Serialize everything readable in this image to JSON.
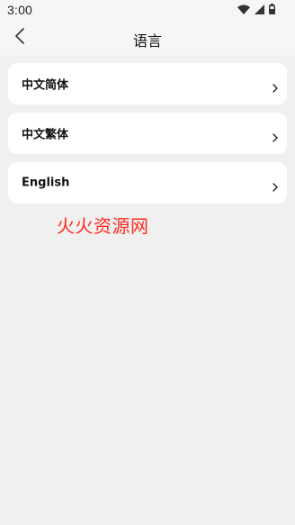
{
  "status_bar": {
    "time": "3:00",
    "icons": [
      "wifi-icon",
      "cellular-signal-icon",
      "battery-icon"
    ]
  },
  "header": {
    "title": "语言",
    "back_icon": "chevron-left-icon"
  },
  "languages": [
    {
      "label": "中文简体",
      "icon": "chevron-right-icon"
    },
    {
      "label": "中文繁体",
      "icon": "chevron-right-icon"
    },
    {
      "label": "English",
      "icon": "chevron-right-icon"
    }
  ],
  "watermark": {
    "text": "火火资源网",
    "color": "#ff2b1f"
  },
  "colors": {
    "background": "#f0f0f0",
    "card": "#ffffff",
    "text": "#111111"
  }
}
